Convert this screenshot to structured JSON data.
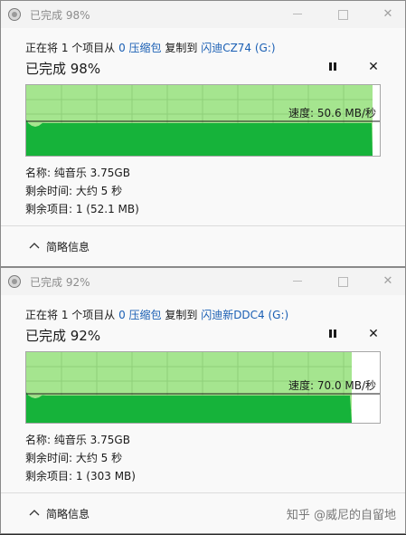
{
  "dialogs": [
    {
      "title": "已完成 98%",
      "desc_prefix": "正在将 1 个项目从 ",
      "source": "0 压缩包",
      "desc_middle": " 复制到 ",
      "destination": "闪迪CZ74 (G:)",
      "percent_text": "已完成 98%",
      "progress": 0.98,
      "speed_text": "速度: 50.6 MB/秒",
      "name_row": "名称:  纯音乐 3.75GB",
      "time_row": "剩余时间:  大约 5 秒",
      "items_row": "剩余项目:  1 (52.1 MB)",
      "more_label": "简略信息"
    },
    {
      "title": "已完成 92%",
      "desc_prefix": "正在将 1 个项目从 ",
      "source": "0 压缩包",
      "desc_middle": " 复制到 ",
      "destination": "闪迪新DDC4 (G:)",
      "percent_text": "已完成 92%",
      "progress": 0.92,
      "speed_text": "速度: 70.0 MB/秒",
      "name_row": "名称:  纯音乐 3.75GB",
      "time_row": "剩余时间:  大约 5 秒",
      "items_row": "剩余项目:  1 (303 MB)",
      "more_label": "简略信息"
    }
  ],
  "window_controls": {
    "minimize": "—",
    "close": "✕"
  },
  "icons": {
    "pause": "pause-icon",
    "cancel": "✕",
    "expand": "chevron-up-icon"
  },
  "colors": {
    "graph_dark": "#16b33a",
    "graph_light": "#a5e58f",
    "link": "#1a5fb4"
  },
  "watermark": "知乎 @威尼的自留地"
}
